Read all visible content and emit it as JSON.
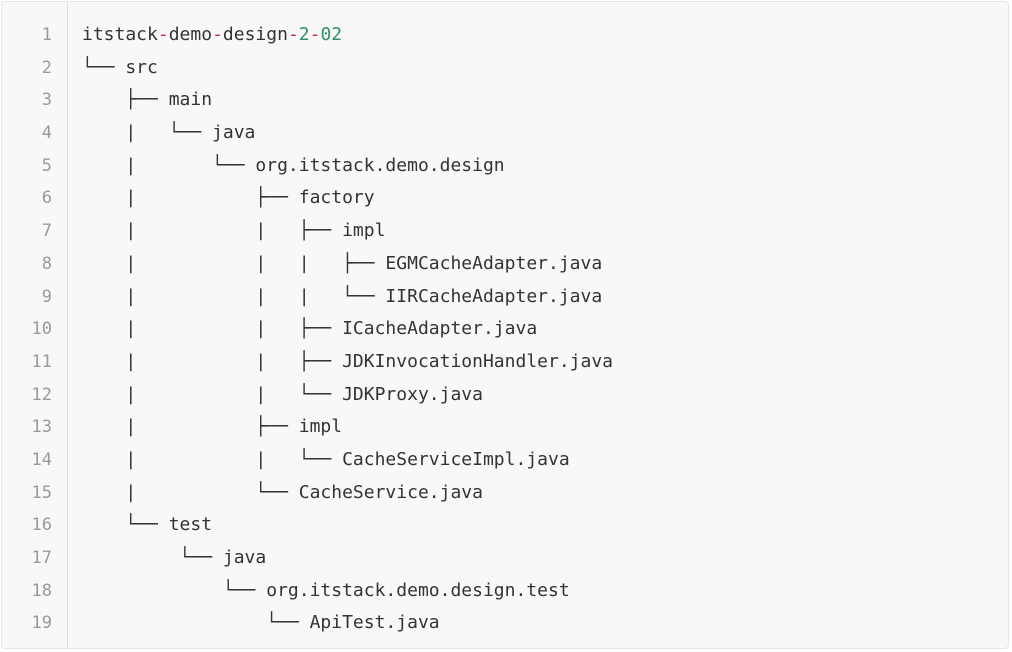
{
  "code_block": {
    "title_tokens": [
      {
        "text": "itstack",
        "kind": "plain"
      },
      {
        "text": "-",
        "kind": "red"
      },
      {
        "text": "demo",
        "kind": "plain"
      },
      {
        "text": "-",
        "kind": "red"
      },
      {
        "text": "design",
        "kind": "plain"
      },
      {
        "text": "-",
        "kind": "red"
      },
      {
        "text": "2",
        "kind": "green"
      },
      {
        "text": "-",
        "kind": "red"
      },
      {
        "text": "02",
        "kind": "green"
      }
    ],
    "lines": [
      {
        "number": "1",
        "text": ""
      },
      {
        "number": "2",
        "text": "└── src"
      },
      {
        "number": "3",
        "text": "    ├── main"
      },
      {
        "number": "4",
        "text": "    |   └── java"
      },
      {
        "number": "5",
        "text": "    |       └── org.itstack.demo.design"
      },
      {
        "number": "6",
        "text": "    |           ├── factory"
      },
      {
        "number": "7",
        "text": "    |           |   ├── impl"
      },
      {
        "number": "8",
        "text": "    |           |   |   ├── EGMCacheAdapter.java"
      },
      {
        "number": "9",
        "text": "    |           |   |   └── IIRCacheAdapter.java"
      },
      {
        "number": "10",
        "text": "    |           |   ├── ICacheAdapter.java"
      },
      {
        "number": "11",
        "text": "    |           |   ├── JDKInvocationHandler.java"
      },
      {
        "number": "12",
        "text": "    |           |   └── JDKProxy.java"
      },
      {
        "number": "13",
        "text": "    |           ├── impl"
      },
      {
        "number": "14",
        "text": "    |           |   └── CacheServiceImpl.java"
      },
      {
        "number": "15",
        "text": "    |           └── CacheService.java"
      },
      {
        "number": "16",
        "text": "    └── test"
      },
      {
        "number": "17",
        "text": "         └── java"
      },
      {
        "number": "18",
        "text": "             └── org.itstack.demo.design.test"
      },
      {
        "number": "19",
        "text": "                 └── ApiTest.java"
      }
    ]
  }
}
